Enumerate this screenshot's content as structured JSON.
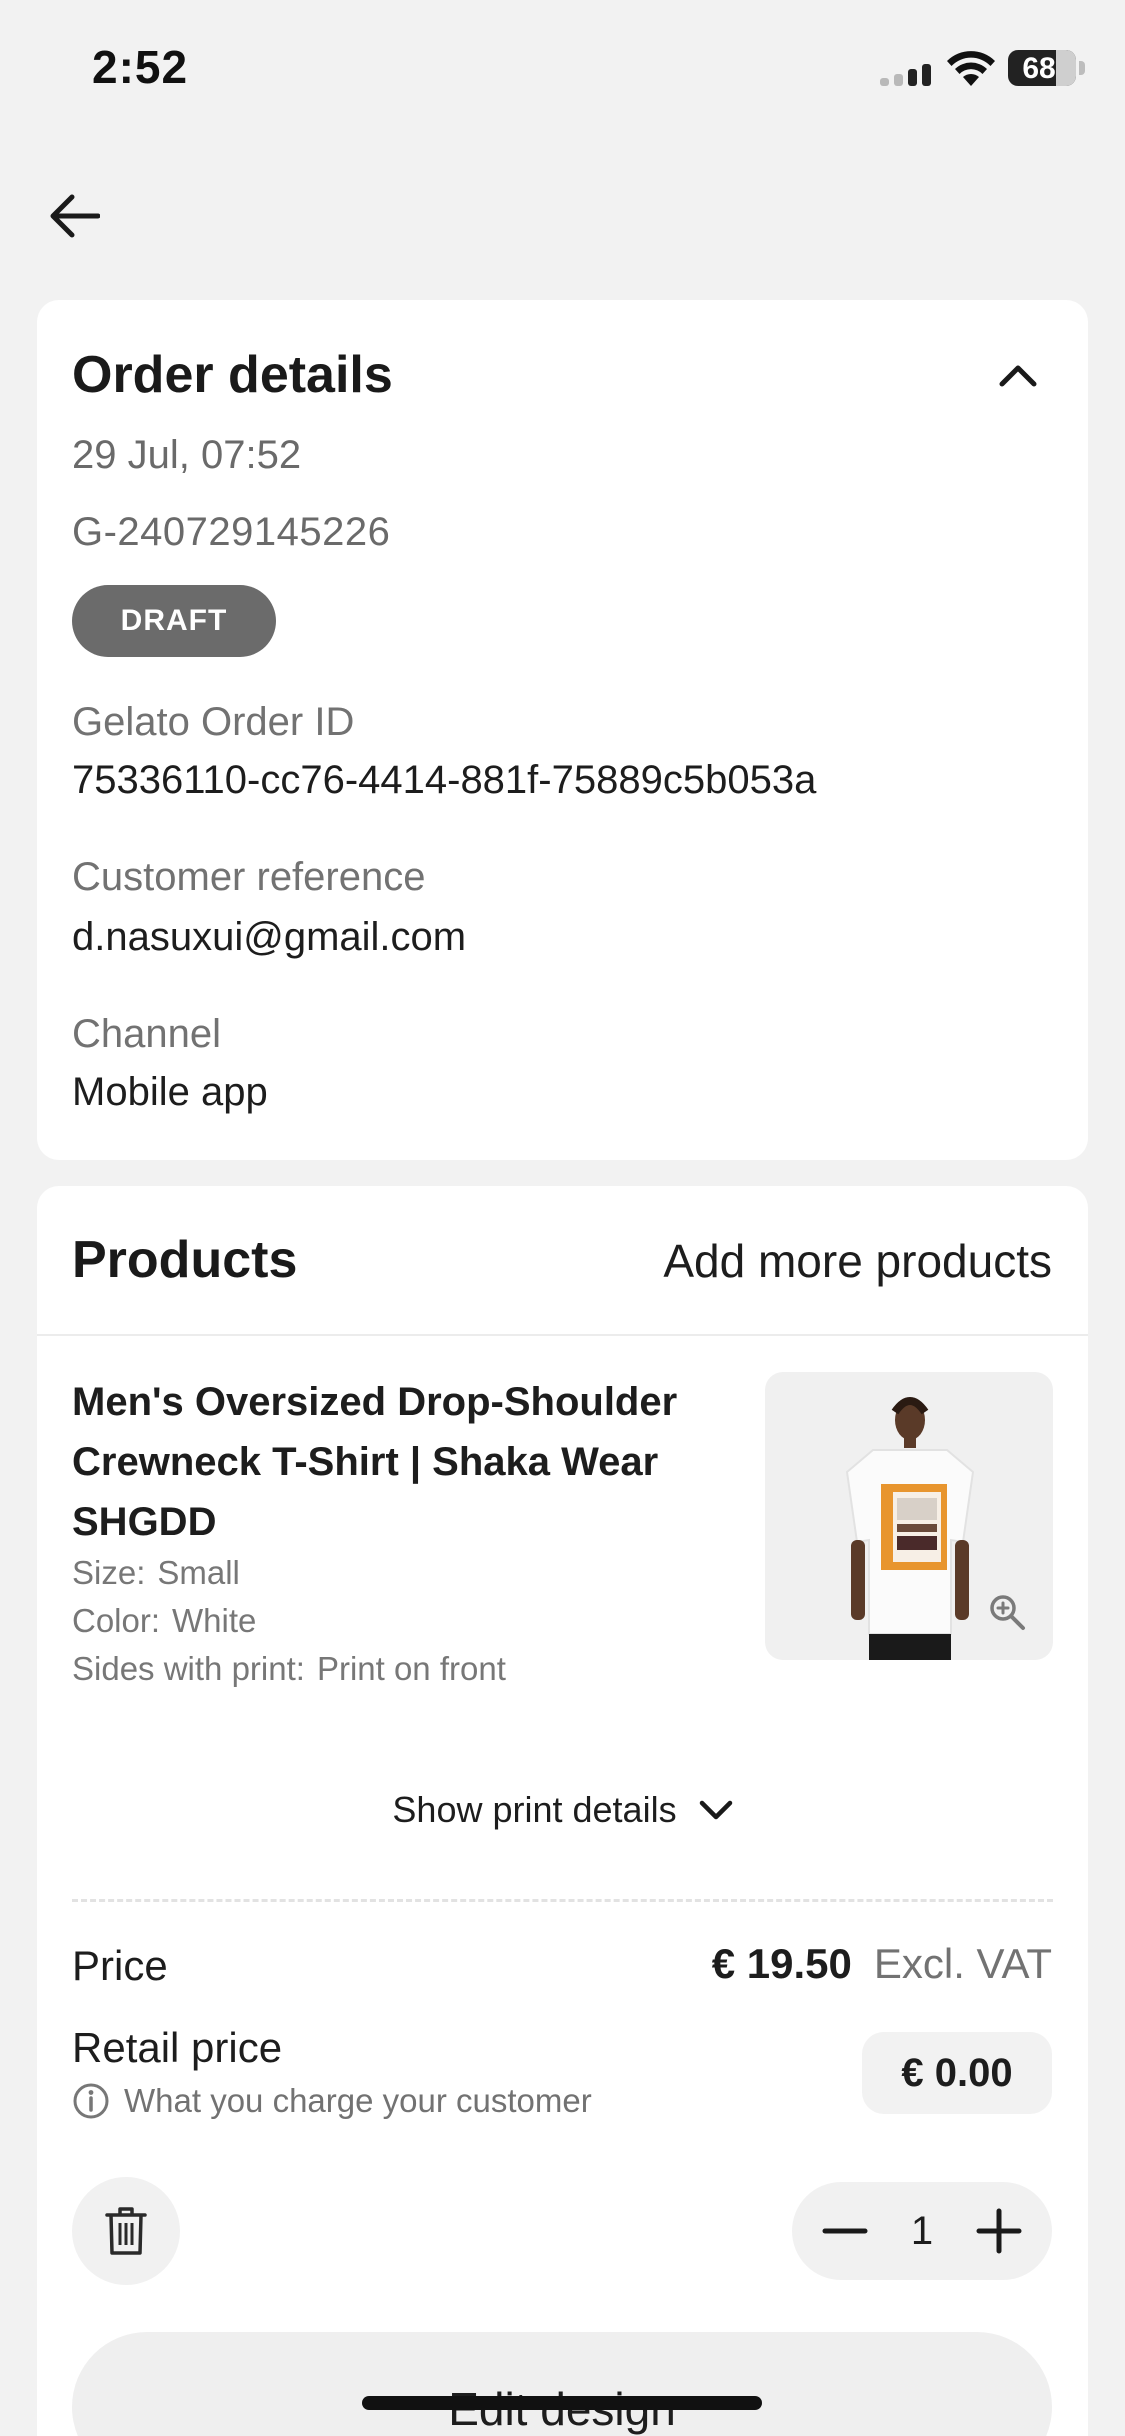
{
  "status_bar": {
    "time": "2:52",
    "battery": "68"
  },
  "order": {
    "title": "Order details",
    "date": "29 Jul, 07:52",
    "number": "G-240729145226",
    "status": "DRAFT",
    "gelato_id_label": "Gelato Order ID",
    "gelato_id": "75336110-cc76-4414-881f-75889c5b053a",
    "customer_ref_label": "Customer reference",
    "customer_ref": "d.nasuxui@gmail.com",
    "channel_label": "Channel",
    "channel": "Mobile app"
  },
  "products": {
    "title": "Products",
    "add_more": "Add more products",
    "item": {
      "name": "Men's Oversized Drop-Shoulder Crewneck T-Shirt | Shaka Wear SHGDD",
      "size_label": "Size:",
      "size": "Small",
      "color_label": "Color:",
      "color": "White",
      "sides_label": "Sides with print:",
      "sides": "Print on front",
      "print_details": "Show print details",
      "price_label": "Price",
      "price": "€ 19.50",
      "price_note": "Excl. VAT",
      "retail_label": "Retail price",
      "retail_help": "What you charge your customer",
      "retail_price": "€ 0.00",
      "quantity": "1",
      "edit_design": "Edit design"
    }
  },
  "icons": {
    "back": "arrow-left-icon",
    "collapse": "chevron-up-icon",
    "expand": "chevron-down-icon",
    "zoom": "zoom-in-icon",
    "info": "info-icon",
    "delete": "trash-icon",
    "decrease": "minus-icon",
    "increase": "plus-icon"
  },
  "colors": {
    "background": "#f2f2f2",
    "badge": "#6b6b6b",
    "text": "#1d1d1d",
    "muted": "#727272"
  }
}
